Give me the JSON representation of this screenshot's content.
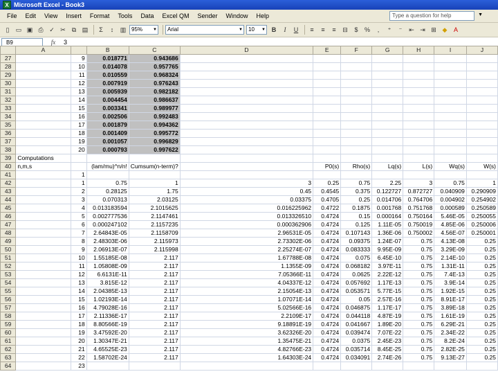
{
  "window": {
    "title": "Microsoft Excel - Book3"
  },
  "menu": [
    "File",
    "Edit",
    "View",
    "Insert",
    "Format",
    "Tools",
    "Data",
    "Excel QM",
    "Sender",
    "Window",
    "Help"
  ],
  "help_placeholder": "Type a question for help",
  "toolbar": {
    "zoom": "95%",
    "font": "Arial",
    "size": "10",
    "sigma": "Σ",
    "currency": "$",
    "percent": "%"
  },
  "formula_bar": {
    "cell": "B9",
    "fx": "fx",
    "content": "3"
  },
  "columns": [
    "A",
    "B",
    "C",
    "D",
    "E",
    "F",
    "G",
    "H",
    "I",
    "J"
  ],
  "rows": [
    {
      "n": "27",
      "c": [
        "",
        "9",
        "0.018771",
        "0.943686",
        "",
        "",
        "",
        "",
        "",
        "",
        ""
      ],
      "sh": true
    },
    {
      "n": "28",
      "c": [
        "",
        "10",
        "0.014078",
        "0.957765",
        "",
        "",
        "",
        "",
        "",
        "",
        ""
      ],
      "sh": true
    },
    {
      "n": "29",
      "c": [
        "",
        "11",
        "0.010559",
        "0.968324",
        "",
        "",
        "",
        "",
        "",
        "",
        ""
      ],
      "sh": true
    },
    {
      "n": "30",
      "c": [
        "",
        "12",
        "0.007919",
        "0.976243",
        "",
        "",
        "",
        "",
        "",
        "",
        ""
      ],
      "sh": true
    },
    {
      "n": "31",
      "c": [
        "",
        "13",
        "0.005939",
        "0.982182",
        "",
        "",
        "",
        "",
        "",
        "",
        ""
      ],
      "sh": true
    },
    {
      "n": "32",
      "c": [
        "",
        "14",
        "0.004454",
        "0.986637",
        "",
        "",
        "",
        "",
        "",
        "",
        ""
      ],
      "sh": true
    },
    {
      "n": "33",
      "c": [
        "",
        "15",
        "0.003341",
        "0.989977",
        "",
        "",
        "",
        "",
        "",
        "",
        ""
      ],
      "sh": true
    },
    {
      "n": "34",
      "c": [
        "",
        "16",
        "0.002506",
        "0.992483",
        "",
        "",
        "",
        "",
        "",
        "",
        ""
      ],
      "sh": true
    },
    {
      "n": "35",
      "c": [
        "",
        "17",
        "0.001879",
        "0.994362",
        "",
        "",
        "",
        "",
        "",
        "",
        ""
      ],
      "sh": true
    },
    {
      "n": "36",
      "c": [
        "",
        "18",
        "0.001409",
        "0.995772",
        "",
        "",
        "",
        "",
        "",
        "",
        ""
      ],
      "sh": true
    },
    {
      "n": "37",
      "c": [
        "",
        "19",
        "0.001057",
        "0.996829",
        "",
        "",
        "",
        "",
        "",
        "",
        ""
      ],
      "sh": true
    },
    {
      "n": "38",
      "c": [
        "",
        "20",
        "0.000793",
        "0.997622",
        "",
        "",
        "",
        "",
        "",
        "",
        ""
      ],
      "sh": true
    },
    {
      "n": "39",
      "c": [
        "Computations",
        "",
        "",
        "",
        "",
        "",
        "",
        "",
        "",
        "",
        ""
      ]
    },
    {
      "n": "40",
      "c": [
        "n,m,s",
        "",
        "(lam/mu)^n/n!",
        "Cumsum(n-term)?",
        "",
        "P0(s)",
        "Rho(s)",
        "Lq(s)",
        "L(s)",
        "Wq(s)",
        "W(s)"
      ]
    },
    {
      "n": "41",
      "c": [
        "",
        "1",
        "",
        "",
        "",
        "",
        "",
        "",
        "",
        "",
        ""
      ]
    },
    {
      "n": "42",
      "c": [
        "",
        "1",
        "0.75",
        "1",
        "3",
        "0.25",
        "0.75",
        "2.25",
        "3",
        "0.75",
        "1"
      ]
    },
    {
      "n": "43",
      "c": [
        "",
        "2",
        "0.28125",
        "1.75",
        "0.45",
        "0.4545",
        "0.375",
        "0.122727",
        "0.872727",
        "0.040909",
        "0.290909"
      ]
    },
    {
      "n": "44",
      "c": [
        "",
        "3",
        "0.070313",
        "2.03125",
        "0.03375",
        "0.4705",
        "0.25",
        "0.014706",
        "0.764706",
        "0.004902",
        "0.254902"
      ]
    },
    {
      "n": "45",
      "c": [
        "",
        "4",
        "0.013183594",
        "2.1015625",
        "0.016225962",
        "0.4722",
        "0.1875",
        "0.001768",
        "0.751768",
        "0.000589",
        "0.250589"
      ]
    },
    {
      "n": "46",
      "c": [
        "",
        "5",
        "0.002777536",
        "2.1147461",
        "0.013326510",
        "0.4724",
        "0.15",
        "0.000164",
        "0.750164",
        "5.46E-05",
        "0.250055"
      ]
    },
    {
      "n": "47",
      "c": [
        "",
        "6",
        "0.000247102",
        "2.1157235",
        "0.000362906",
        "0.4724",
        "0.125",
        "1.11E-05",
        "0.750019",
        "4.85E-06",
        "0.250006"
      ]
    },
    {
      "n": "48",
      "c": [
        "",
        "7",
        "2.64843E-05",
        "2.1158709",
        "2.96531E-05",
        "0.4724",
        "0.107143",
        "1.36E-06",
        "0.750002",
        "4.56E-07",
        "0.250001"
      ]
    },
    {
      "n": "49",
      "c": [
        "",
        "8",
        "2.48303E-06",
        "2.115973",
        "2.73302E-06",
        "0.4724",
        "0.09375",
        "1.24E-07",
        "0.75",
        "4.13E-08",
        "0.25"
      ]
    },
    {
      "n": "50",
      "c": [
        "",
        "9",
        "2.06913E-07",
        "2.115998",
        "2.25274E-07",
        "0.4724",
        "0.083333",
        "9.95E-09",
        "0.75",
        "3.29E-09",
        "0.25"
      ]
    },
    {
      "n": "51",
      "c": [
        "",
        "10",
        "1.55185E-08",
        "2.117",
        "1.67788E-08",
        "0.4724",
        "0.075",
        "6.45E-10",
        "0.75",
        "2.14E-10",
        "0.25"
      ]
    },
    {
      "n": "52",
      "c": [
        "",
        "11",
        "1.05808E-09",
        "2.117",
        "1.1355E-09",
        "0.4724",
        "0.068182",
        "3.97E-11",
        "0.75",
        "1.31E-11",
        "0.25"
      ]
    },
    {
      "n": "53",
      "c": [
        "",
        "12",
        "6.6131E-11",
        "2.117",
        "7.05366E-11",
        "0.4724",
        "0.0625",
        "2.22E-12",
        "0.75",
        "7.4E-13",
        "0.25"
      ]
    },
    {
      "n": "54",
      "c": [
        "",
        "13",
        "3.815E-12",
        "2.117",
        "4.04337E-12",
        "0.4724",
        "0.057692",
        "1.17E-13",
        "0.75",
        "3.9E-14",
        "0.25"
      ]
    },
    {
      "n": "55",
      "c": [
        "",
        "14",
        "2.04385E-13",
        "2.117",
        "2.15054E-13",
        "0.4724",
        "0.053571",
        "5.77E-15",
        "0.75",
        "1.92E-15",
        "0.25"
      ]
    },
    {
      "n": "56",
      "c": [
        "",
        "15",
        "1.02193E-14",
        "2.117",
        "1.07071E-14",
        "0.4724",
        "0.05",
        "2.57E-16",
        "0.75",
        "8.91E-17",
        "0.25"
      ]
    },
    {
      "n": "57",
      "c": [
        "",
        "16",
        "4.79028E-16",
        "2.117",
        "5.02566E-16",
        "0.4724",
        "0.046875",
        "1.17E-17",
        "0.75",
        "3.89E-18",
        "0.25"
      ]
    },
    {
      "n": "58",
      "c": [
        "",
        "17",
        "2.11336E-17",
        "2.117",
        "2.2109E-17",
        "0.4724",
        "0.044118",
        "4.87E-19",
        "0.75",
        "1.61E-19",
        "0.25"
      ]
    },
    {
      "n": "59",
      "c": [
        "",
        "18",
        "8.80566E-19",
        "2.117",
        "9.18891E-19",
        "0.4724",
        "0.041667",
        "1.89E-20",
        "0.75",
        "6.29E-21",
        "0.25"
      ]
    },
    {
      "n": "60",
      "c": [
        "",
        "19",
        "3.47592E-20",
        "2.117",
        "3.62326E-20",
        "0.4724",
        "0.039474",
        "7.07E-22",
        "0.75",
        "2.34E-22",
        "0.25"
      ]
    },
    {
      "n": "61",
      "c": [
        "",
        "20",
        "1.30347E-21",
        "2.117",
        "1.35475E-21",
        "0.4724",
        "0.0375",
        "2.45E-23",
        "0.75",
        "8.2E-24",
        "0.25"
      ]
    },
    {
      "n": "62",
      "c": [
        "",
        "21",
        "4.65525E-23",
        "2.117",
        "4.82766E-23",
        "0.4724",
        "0.035714",
        "8.45E-25",
        "0.75",
        "2.82E-25",
        "0.25"
      ]
    },
    {
      "n": "63",
      "c": [
        "",
        "22",
        "1.58702E-24",
        "2.117",
        "1.64303E-24",
        "0.4724",
        "0.034091",
        "2.74E-26",
        "0.75",
        "9.13E-27",
        "0.25"
      ]
    },
    {
      "n": "64",
      "c": [
        "",
        "23",
        "",
        "",
        "",
        "",
        "",
        "",
        "",
        "",
        ""
      ]
    }
  ]
}
